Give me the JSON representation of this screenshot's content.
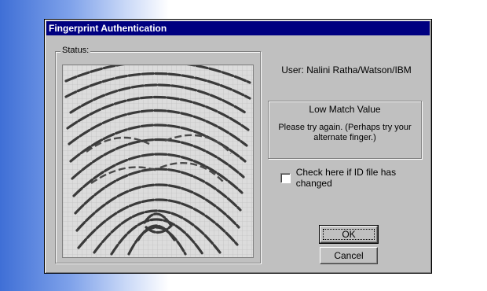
{
  "window": {
    "title": "Fingerprint Authentication"
  },
  "status_group": {
    "label": "Status:",
    "image_icon": "fingerprint-image"
  },
  "user": {
    "text": "User: Nalini Ratha/Watson/IBM"
  },
  "message": {
    "title": "Low Match Value",
    "body": "Please try again. (Perhaps try your alternate finger.)"
  },
  "id_checkbox": {
    "label": "Check here if ID file has changed",
    "checked": false
  },
  "buttons": {
    "ok_label": "OK",
    "cancel_label": "Cancel"
  },
  "colors": {
    "title_bar": "#000080",
    "dialog_face": "#c0c0c0",
    "desktop_gradient": "#3f6fd6"
  }
}
